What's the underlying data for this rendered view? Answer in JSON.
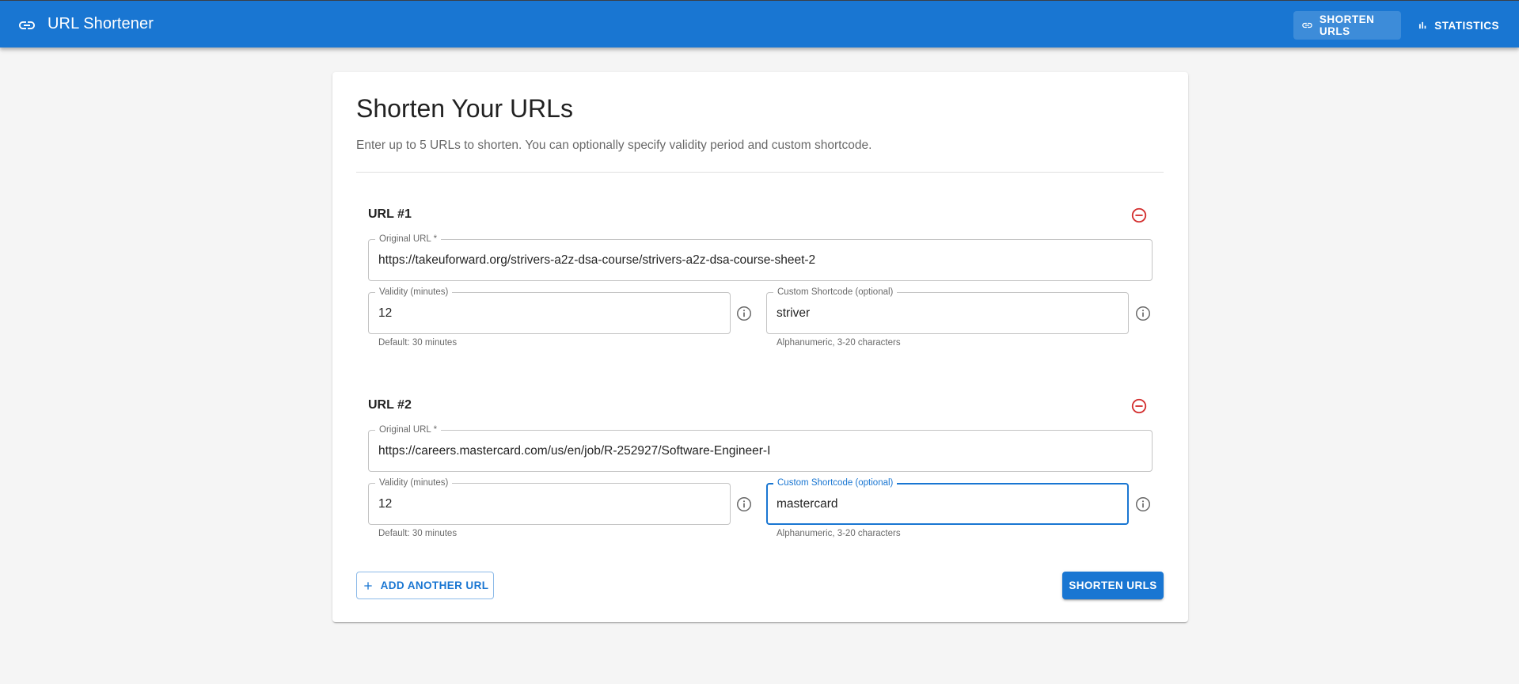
{
  "app": {
    "title": "URL Shortener",
    "accent_color": "#1976d2",
    "nav": [
      {
        "label": "SHORTEN URLS",
        "icon": "link-icon",
        "active": true
      },
      {
        "label": "STATISTICS",
        "icon": "bar-chart-icon",
        "active": false
      }
    ]
  },
  "form": {
    "heading": "Shorten Your URLs",
    "subtitle": "Enter up to 5 URLs to shorten. You can optionally specify validity period and custom shortcode.",
    "urls": [
      {
        "title": "URL #1",
        "original_label": "Original URL *",
        "original_value": "https://takeuforward.org/strivers-a2z-dsa-course/strivers-a2z-dsa-course-sheet-2",
        "validity_label": "Validity (minutes)",
        "validity_value": "12",
        "validity_helper": "Default: 30 minutes",
        "shortcode_label": "Custom Shortcode (optional)",
        "shortcode_value": "striver",
        "shortcode_helper": "Alphanumeric, 3-20 characters"
      },
      {
        "title": "URL #2",
        "original_label": "Original URL *",
        "original_value": "https://careers.mastercard.com/us/en/job/R-252927/Software-Engineer-I",
        "validity_label": "Validity (minutes)",
        "validity_value": "12",
        "validity_helper": "Default: 30 minutes",
        "shortcode_label": "Custom Shortcode (optional)",
        "shortcode_value": "mastercard",
        "shortcode_helper": "Alphanumeric, 3-20 characters",
        "shortcode_focused": true
      }
    ],
    "add_label": "ADD ANOTHER URL",
    "submit_label": "SHORTEN URLS",
    "remove_color": "#d32f2f"
  }
}
